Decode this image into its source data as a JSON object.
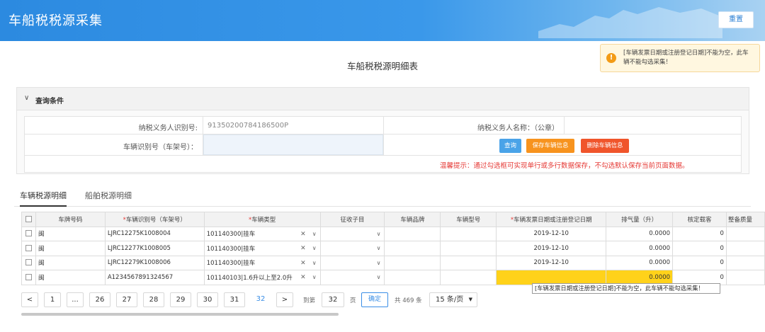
{
  "header": {
    "app_title": "车船税税源采集",
    "reset_label": "重置"
  },
  "toast": {
    "line1": "[车辆发票日期或注册登记日期]不能为空，此车",
    "line2": "辆不能勾选采集！",
    "icon": "!"
  },
  "page_title": "车船税税源明细表",
  "query": {
    "section_title": "查询条件",
    "taxpayer_id_label": "纳税义务人识别号:",
    "taxpayer_id_value": "91350200784186500P",
    "taxpayer_name_label": "纳税义务人名称：（公章）",
    "vin_label": "车辆识别号（车架号）：",
    "vin_value": "",
    "btn_query": "查询",
    "btn_save": "保存车辆信息",
    "btn_delete": "删除车辆信息",
    "hint": "温馨提示：通过勾选框可实现单行或多行数据保存，不勾选默认保存当前页面数据。"
  },
  "tabs": {
    "vehicle": "车辆税源明细",
    "ship": "船舶税源明细"
  },
  "table": {
    "headers": {
      "plate": "车牌号码",
      "vin": "车辆识别号（车架号）",
      "type": "车辆类型",
      "tax_item": "征收子目",
      "brand": "车辆品牌",
      "model": "车辆型号",
      "invoice_date": "车辆发票日期或注册登记日期",
      "displacement": "排气量（升）",
      "seats": "核定载客",
      "weight": "整备质量"
    },
    "rows": [
      {
        "plate": "闽",
        "vin": "LJRC12275K1008004",
        "type": "101140300|挂车",
        "invoice_date": "2019-12-10",
        "displacement": "0.0000",
        "seats": "0"
      },
      {
        "plate": "闽",
        "vin": "LJRC12277K1008005",
        "type": "101140300|挂车",
        "invoice_date": "2019-12-10",
        "displacement": "0.0000",
        "seats": "0"
      },
      {
        "plate": "闽",
        "vin": "LJRC12279K1008006",
        "type": "101140300|挂车",
        "invoice_date": "2019-12-10",
        "displacement": "0.0000",
        "seats": "0"
      },
      {
        "plate": "闽",
        "vin": "A1234567891324567",
        "type": "101140103|1.6升以上至2.0升",
        "invoice_date": "",
        "displacement": "0.0000",
        "seats": "0"
      }
    ]
  },
  "tooltip": "[车辆发票日期或注册登记日期]不能为空，此车辆不能勾选采集！",
  "pager": {
    "prev": "<",
    "next": ">",
    "pages": [
      "1",
      "...",
      "26",
      "27",
      "28",
      "29",
      "30",
      "31",
      "32"
    ],
    "goto_label": "到第",
    "goto_value": "32",
    "page_unit": "页",
    "confirm": "确定",
    "total": "共 469 条",
    "per_page": "15 条/页"
  },
  "colors": {
    "header_blue": "#2c8ae0",
    "save_orange": "#f7931e",
    "delete_red": "#f0552b",
    "query_blue": "#4aa3e8",
    "error_yellow": "#ffd21a"
  }
}
